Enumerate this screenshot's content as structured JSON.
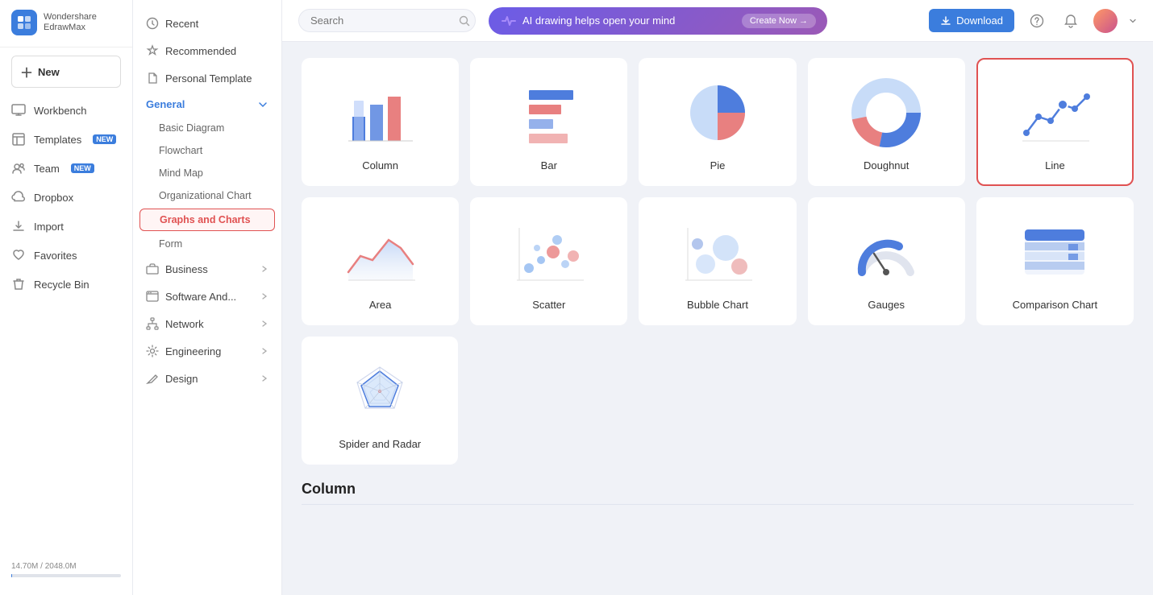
{
  "app": {
    "name": "Wondershare",
    "subname": "EdrawMax",
    "logo_letter": "E"
  },
  "nav": {
    "new_label": "New",
    "items": [
      {
        "id": "workbench",
        "label": "Workbench",
        "icon": "monitor"
      },
      {
        "id": "templates",
        "label": "Templates",
        "badge": "NEW",
        "icon": "template"
      },
      {
        "id": "team",
        "label": "Team",
        "badge": "NEW",
        "icon": "people"
      },
      {
        "id": "dropbox",
        "label": "Dropbox",
        "icon": "cloud"
      },
      {
        "id": "import",
        "label": "Import",
        "icon": "import"
      },
      {
        "id": "favorites",
        "label": "Favorites",
        "icon": "heart"
      },
      {
        "id": "recycle",
        "label": "Recycle Bin",
        "icon": "trash"
      }
    ]
  },
  "storage": {
    "used": "14.70M",
    "total": "2048.0M",
    "label": "14.70M / 2048.0M"
  },
  "mid_sidebar": {
    "items": [
      {
        "id": "recent",
        "label": "Recent",
        "icon": "clock"
      },
      {
        "id": "recommended",
        "label": "Recommended",
        "icon": "star"
      },
      {
        "id": "personal",
        "label": "Personal Template",
        "icon": "file"
      }
    ],
    "categories": [
      {
        "id": "general",
        "label": "General",
        "expanded": true,
        "sub_items": [
          {
            "id": "basic",
            "label": "Basic Diagram",
            "active": false
          },
          {
            "id": "flowchart",
            "label": "Flowchart",
            "active": false
          },
          {
            "id": "mindmap",
            "label": "Mind Map",
            "active": false
          },
          {
            "id": "org",
            "label": "Organizational Chart",
            "active": false
          },
          {
            "id": "graphs",
            "label": "Graphs and Charts",
            "active": true
          },
          {
            "id": "form",
            "label": "Form",
            "active": false
          }
        ]
      },
      {
        "id": "business",
        "label": "Business",
        "has_arrow": true
      },
      {
        "id": "software",
        "label": "Software And...",
        "has_arrow": true
      },
      {
        "id": "network",
        "label": "Network",
        "has_arrow": true
      },
      {
        "id": "engineering",
        "label": "Engineering",
        "has_arrow": true
      },
      {
        "id": "design",
        "label": "Design",
        "has_arrow": true
      }
    ]
  },
  "topbar": {
    "search_placeholder": "Search",
    "ai_text": "AI drawing helps open your mind",
    "create_now": "Create Now →",
    "download_label": "Download"
  },
  "charts": [
    {
      "id": "column",
      "label": "Column",
      "selected": false,
      "type": "column"
    },
    {
      "id": "bar",
      "label": "Bar",
      "selected": false,
      "type": "bar"
    },
    {
      "id": "pie",
      "label": "Pie",
      "selected": false,
      "type": "pie"
    },
    {
      "id": "doughnut",
      "label": "Doughnut",
      "selected": false,
      "type": "doughnut"
    },
    {
      "id": "line",
      "label": "Line",
      "selected": true,
      "type": "line"
    },
    {
      "id": "area",
      "label": "Area",
      "selected": false,
      "type": "area"
    },
    {
      "id": "scatter",
      "label": "Scatter",
      "selected": false,
      "type": "scatter"
    },
    {
      "id": "bubble",
      "label": "Bubble Chart",
      "selected": false,
      "type": "bubble"
    },
    {
      "id": "gauges",
      "label": "Gauges",
      "selected": false,
      "type": "gauges"
    },
    {
      "id": "comparison",
      "label": "Comparison Chart",
      "selected": false,
      "type": "comparison"
    },
    {
      "id": "spider",
      "label": "Spider and Radar",
      "selected": false,
      "type": "spider"
    }
  ],
  "bottom_section": {
    "title": "Column"
  }
}
